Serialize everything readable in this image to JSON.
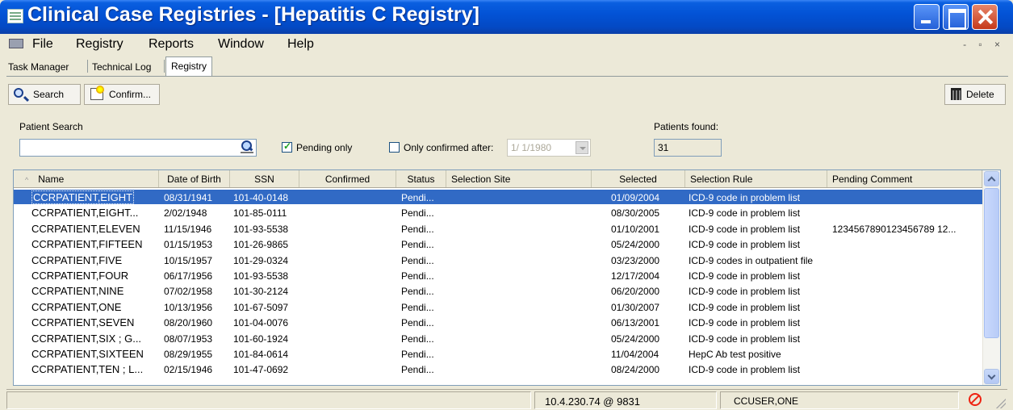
{
  "window": {
    "title": "Clinical Case Registries - [Hepatitis C Registry]"
  },
  "menu": [
    "File",
    "Registry",
    "Reports",
    "Window",
    "Help"
  ],
  "mdi_controls": "- ▫ ×",
  "tabs": [
    "Task Manager",
    "Technical Log",
    "Registry"
  ],
  "toolbar": {
    "search": "Search",
    "confirm": "Confirm...",
    "delete": "Delete"
  },
  "search": {
    "label": "Patient Search",
    "value": "",
    "pending_only_label": "Pending only",
    "pending_only_checked": true,
    "only_confirmed_label": "Only confirmed after:",
    "only_confirmed_checked": false,
    "confirmed_date": "1/ 1/1980",
    "found_label": "Patients found:",
    "found_value": "31"
  },
  "table": {
    "sort_indicator": "^",
    "columns": [
      "Name",
      "Date of Birth",
      "SSN",
      "Confirmed",
      "Status",
      "Selection Site",
      "Selected",
      "Selection Rule",
      "Pending Comment"
    ],
    "rows": [
      [
        "CCRPATIENT,EIGHT",
        "08/31/1941",
        "101-40-0148",
        "",
        "Pendi...",
        "",
        "01/09/2004",
        "ICD-9 code in problem list",
        ""
      ],
      [
        "CCRPATIENT,EIGHT...",
        "2/02/1948",
        "101-85-0111",
        "",
        "Pendi...",
        "",
        "08/30/2005",
        "ICD-9 code in problem list",
        ""
      ],
      [
        "CCRPATIENT,ELEVEN",
        "11/15/1946",
        "101-93-5538",
        "",
        "Pendi...",
        "",
        "01/10/2001",
        "ICD-9 code in problem list",
        "1234567890123456789 12..."
      ],
      [
        "CCRPATIENT,FIFTEEN",
        "01/15/1953",
        "101-26-9865",
        "",
        "Pendi...",
        "",
        "05/24/2000",
        "ICD-9 code in problem list",
        ""
      ],
      [
        "CCRPATIENT,FIVE",
        "10/15/1957",
        "101-29-0324",
        "",
        "Pendi...",
        "",
        "03/23/2000",
        "ICD-9 codes in outpatient file",
        ""
      ],
      [
        "CCRPATIENT,FOUR",
        "06/17/1956",
        "101-93-5538",
        "",
        "Pendi...",
        "",
        "12/17/2004",
        "ICD-9 code in problem list",
        ""
      ],
      [
        "CCRPATIENT,NINE",
        "07/02/1958",
        "101-30-2124",
        "",
        "Pendi...",
        "",
        "06/20/2000",
        "ICD-9 code in problem list",
        ""
      ],
      [
        "CCRPATIENT,ONE",
        "10/13/1956",
        "101-67-5097",
        "",
        "Pendi...",
        "",
        "01/30/2007",
        "ICD-9 code in problem list",
        ""
      ],
      [
        "CCRPATIENT,SEVEN",
        "08/20/1960",
        "101-04-0076",
        "",
        "Pendi...",
        "",
        "06/13/2001",
        "ICD-9 code in problem list",
        ""
      ],
      [
        "CCRPATIENT,SIX ; G...",
        "08/07/1953",
        "101-60-1924",
        "",
        "Pendi...",
        "",
        "05/24/2000",
        "ICD-9 code in problem list",
        ""
      ],
      [
        "CCRPATIENT,SIXTEEN",
        "08/29/1955",
        "101-84-0614",
        "",
        "Pendi...",
        "",
        "11/04/2004",
        "HepC Ab test positive",
        ""
      ],
      [
        "CCRPATIENT,TEN ; L...",
        "02/15/1946",
        "101-47-0692",
        "",
        "Pendi...",
        "",
        "08/24/2000",
        "ICD-9 code in problem list",
        ""
      ]
    ]
  },
  "status": {
    "server": "10.4.230.74 @ 9831",
    "user": "CCUSER,ONE"
  }
}
